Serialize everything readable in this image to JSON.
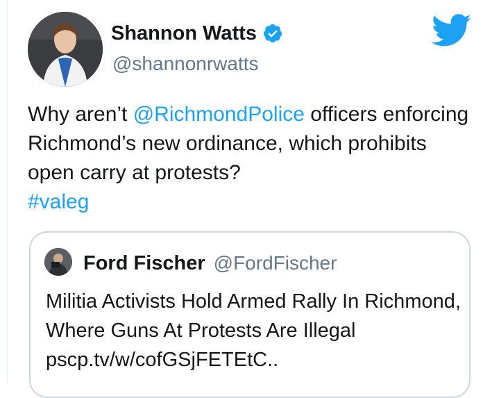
{
  "tweet": {
    "author_name": "Shannon Watts",
    "author_handle": "@shannonrwatts",
    "text_1": "Why aren’t ",
    "mention": "@RichmondPolice",
    "text_2": " officers enforcing Richmond’s new ordinance, which prohibits open carry at protests?",
    "hashtag": "#valeg"
  },
  "quote": {
    "author_name": "Ford Fischer",
    "author_handle": "@FordFischer",
    "text": "Militia Activists Hold Armed Rally In Richmond, Where Guns At Protests Are Illegal pscp.tv/w/cofGSjFETEtC.."
  },
  "icons": {
    "verified": "verified-badge-icon",
    "brand": "twitter-bird-icon"
  },
  "colors": {
    "accent": "#1da1f2",
    "text": "#14171a",
    "secondary": "#657786",
    "border": "#ccd6dd"
  }
}
